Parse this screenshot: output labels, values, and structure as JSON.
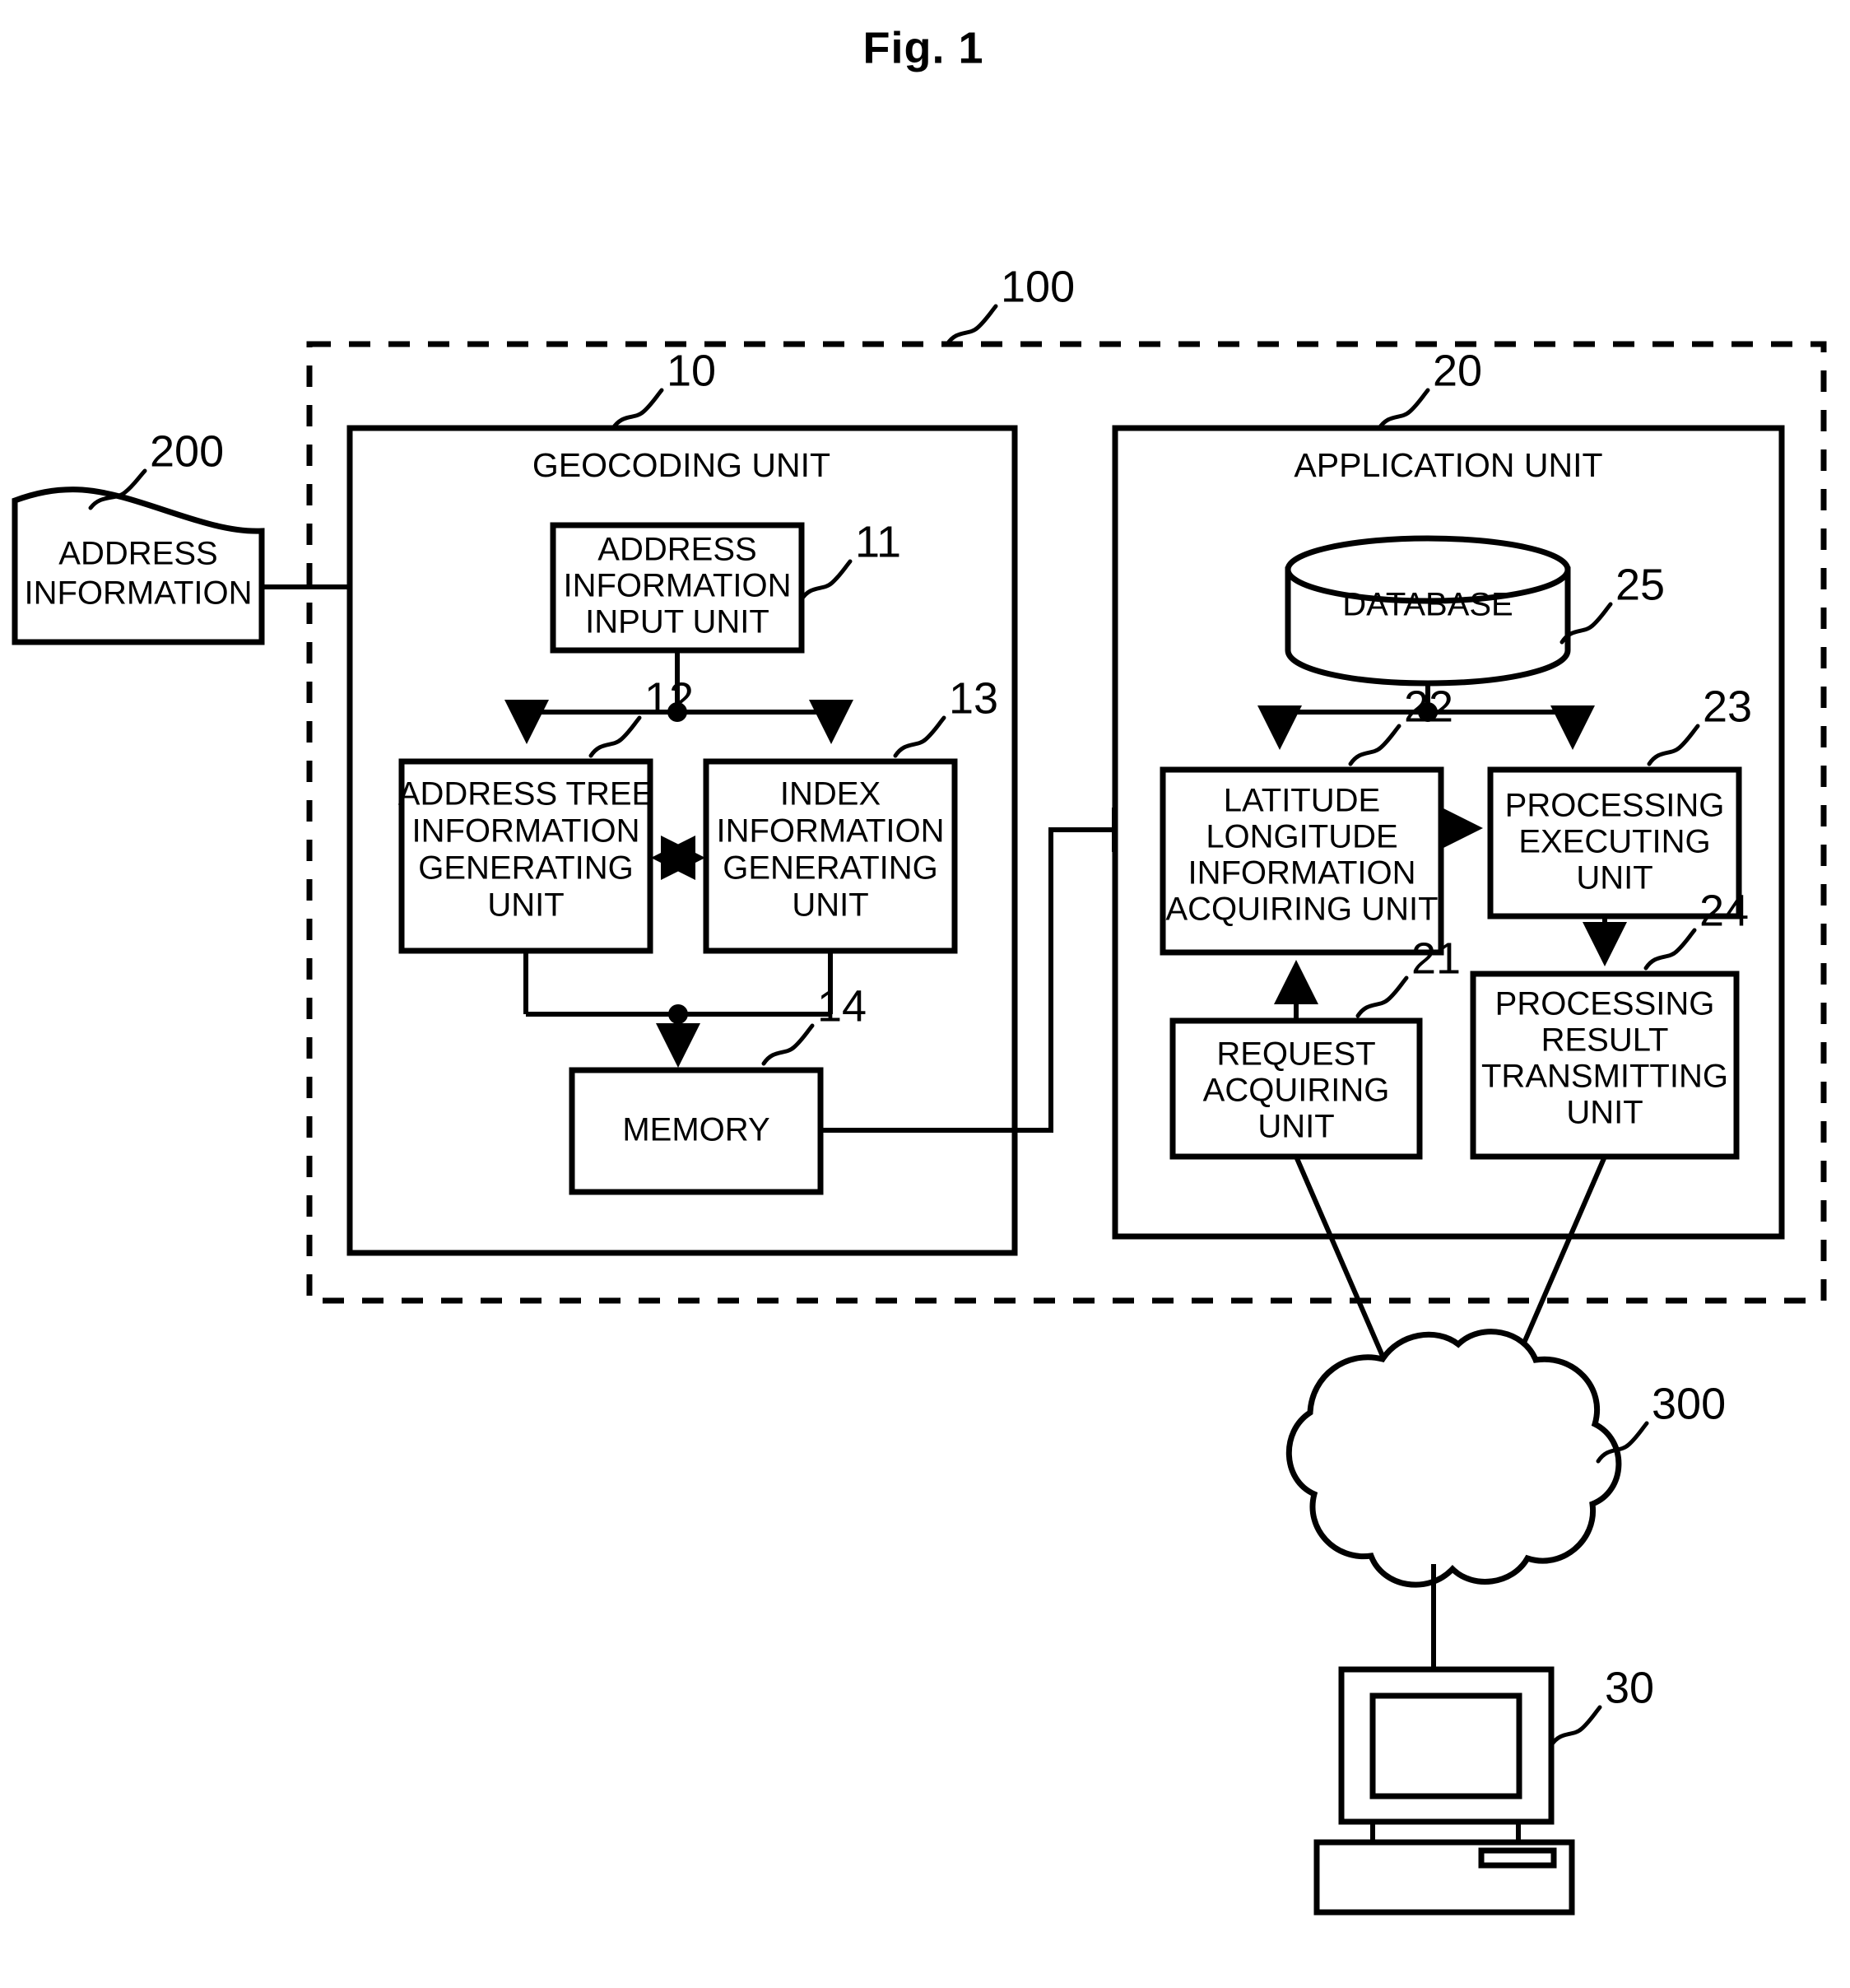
{
  "figure": {
    "title": "Fig. 1"
  },
  "external": {
    "address_information": {
      "label_line1": "ADDRESS",
      "label_line2": "INFORMATION",
      "ref": "200"
    },
    "network_cloud": {
      "ref": "300"
    },
    "terminal": {
      "ref": "30"
    }
  },
  "system": {
    "ref": "100"
  },
  "geocoding_unit": {
    "title": "GEOCODING UNIT",
    "ref": "10",
    "blocks": [
      {
        "ref": "11",
        "lines": [
          "ADDRESS",
          "INFORMATION",
          "INPUT UNIT"
        ]
      },
      {
        "ref": "12",
        "lines": [
          "ADDRESS TREE",
          "INFORMATION",
          "GENERATING",
          "UNIT"
        ]
      },
      {
        "ref": "13",
        "lines": [
          "INDEX",
          "INFORMATION",
          "GENERATING",
          "UNIT"
        ]
      },
      {
        "ref": "14",
        "lines": [
          "MEMORY"
        ]
      }
    ]
  },
  "application_unit": {
    "title": "APPLICATION UNIT",
    "ref": "20",
    "blocks": [
      {
        "ref": "25",
        "lines": [
          "DATABASE"
        ]
      },
      {
        "ref": "21",
        "lines": [
          "REQUEST",
          "ACQUIRING",
          "UNIT"
        ]
      },
      {
        "ref": "22",
        "lines": [
          "LATITUDE",
          "LONGITUDE",
          "INFORMATION",
          "ACQUIRING UNIT"
        ]
      },
      {
        "ref": "23",
        "lines": [
          "PROCESSING",
          "EXECUTING",
          "UNIT"
        ]
      },
      {
        "ref": "24",
        "lines": [
          "PROCESSING",
          "RESULT",
          "TRANSMITTING",
          "UNIT"
        ]
      }
    ]
  }
}
